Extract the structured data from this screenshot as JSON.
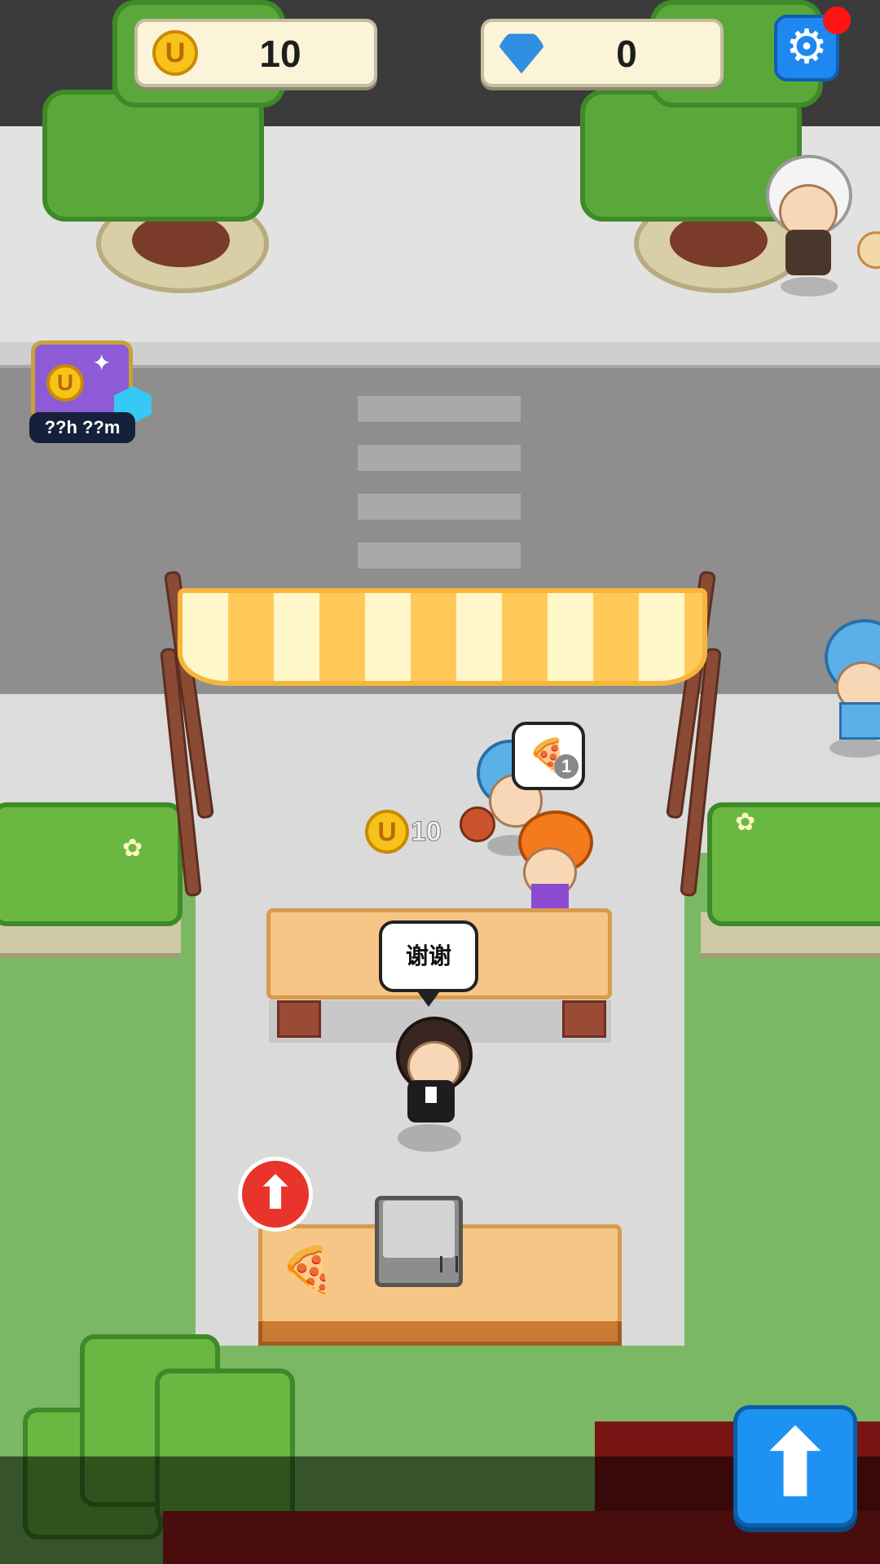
{
  "hud": {
    "coins": "10",
    "gems": "0",
    "coin_symbol": "U",
    "gem_icon": "gem-icon",
    "settings_icon": "gear-icon"
  },
  "chest": {
    "timer": "??h ??m"
  },
  "speech": {
    "server_bubble": "谢谢",
    "order_quantity": "1",
    "order_item_icon": "pizza-icon"
  },
  "floating_reward": {
    "amount": "10"
  },
  "kitchen": {
    "item_icon": "pizza-icon"
  },
  "buttons": {
    "upgrade_icon": "arrow-up-icon",
    "build_marker_icon": "arrow-up-icon"
  },
  "colors": {
    "accent_blue": "#1e88f0",
    "coin_gold": "#f7c21a",
    "notify_red": "#ff1414",
    "awning_yellow": "#ffc95a"
  }
}
